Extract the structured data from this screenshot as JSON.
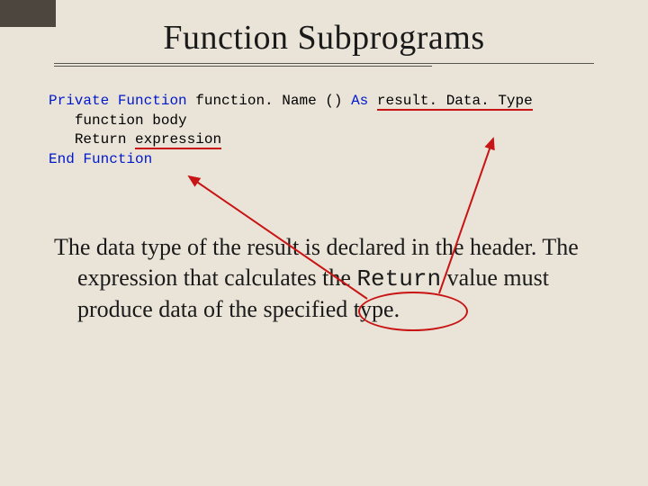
{
  "title": "Function Subprograms",
  "code": {
    "kw_private": "Private",
    "kw_function": "Function",
    "fname": " function. Name () ",
    "kw_as": "As",
    "sp": " ",
    "rtype": "result. Data. Type",
    "indent": "   ",
    "body_line": "function body",
    "return_kw": "Return ",
    "expr": "expression",
    "kw_end": "End",
    "kw_function2": "Function"
  },
  "para": {
    "t1": "The data type of the result is declared in the header. The expression that calculates the ",
    "mono": "Return",
    "t2": " value must produce data of the specified type."
  }
}
